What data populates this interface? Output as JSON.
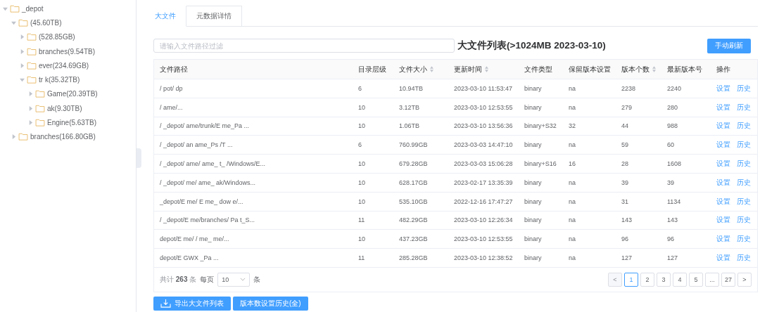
{
  "tree": [
    {
      "label": "_depot",
      "expanded": true,
      "children": [
        {
          "label": "(45.60TB)",
          "expanded": true,
          "children": [
            {
              "label": "(528.85GB)",
              "expanded": false
            },
            {
              "label": "branches(9.54TB)",
              "expanded": false
            },
            {
              "label": "ever(234.69GB)",
              "expanded": false
            },
            {
              "label": "tr k(35.32TB)",
              "expanded": true,
              "children": [
                {
                  "label": "Game(20.39TB)",
                  "expanded": false
                },
                {
                  "label": "ak(9.30TB)",
                  "expanded": false
                },
                {
                  "label": "Engine(5.63TB)",
                  "expanded": false
                }
              ]
            }
          ]
        },
        {
          "label": "branches(166.80GB)",
          "expanded": false
        }
      ]
    }
  ],
  "tabs": [
    {
      "label": "大文件",
      "selected": true
    },
    {
      "label": "元数据详情",
      "selected": false
    }
  ],
  "filter": {
    "placeholder": "请输入文件路径过滤"
  },
  "list_title": "大文件列表(>1024MB 2023-03-10)",
  "refresh_button": "手动刷新",
  "table": {
    "columns": [
      {
        "label": "文件路径",
        "sortable": false
      },
      {
        "label": "目录层级",
        "sortable": false
      },
      {
        "label": "文件大小",
        "sortable": true
      },
      {
        "label": "更新时间",
        "sortable": true
      },
      {
        "label": "文件类型",
        "sortable": false
      },
      {
        "label": "保留版本设置",
        "sortable": false
      },
      {
        "label": "版本个数",
        "sortable": true
      },
      {
        "label": "最新版本号",
        "sortable": false
      },
      {
        "label": "操作",
        "sortable": false
      }
    ],
    "rows": [
      {
        "cells": [
          "/  pot/  dp",
          "6",
          "10.94TB",
          "2023-03-10 11:53:47",
          "binary",
          "na",
          "2238",
          "2240"
        ],
        "actions": [
          "设置",
          "历史"
        ]
      },
      {
        "cells": [
          "/  ame/...",
          "10",
          "3.12TB",
          "2023-03-10 12:53:55",
          "binary",
          "na",
          "279",
          "280"
        ],
        "actions": [
          "设置",
          "历史"
        ]
      },
      {
        "cells": [
          "/  _depot/  ame/trunk/E  me_Pa  ...",
          "10",
          "1.06TB",
          "2023-03-10 13:56:36",
          "binary+S32",
          "32",
          "44",
          "988"
        ],
        "actions": [
          "设置",
          "历史"
        ]
      },
      {
        "cells": [
          "/  _depot/  an  ame_Ps  /T  ...",
          "6",
          "760.99GB",
          "2023-03-03 14:47:10",
          "binary",
          "na",
          "59",
          "60"
        ],
        "actions": [
          "设置",
          "历史"
        ]
      },
      {
        "cells": [
          "/  _depot/  ame/  ame_  t_  /Windows/E...",
          "10",
          "679.28GB",
          "2023-03-03 15:06:28",
          "binary+S16",
          "16",
          "28",
          "1608"
        ],
        "actions": [
          "设置",
          "历史"
        ]
      },
      {
        "cells": [
          "/  _depot/  me/  ame_  ak/Windows...",
          "10",
          "628.17GB",
          "2023-02-17 13:35:39",
          "binary",
          "na",
          "39",
          "39"
        ],
        "actions": [
          "设置",
          "历史"
        ]
      },
      {
        "cells": [
          "_depot/E  me/  E  me_  dow  e/...",
          "10",
          "535.10GB",
          "2022-12-16 17:47:27",
          "binary",
          "na",
          "31",
          "1134"
        ],
        "actions": [
          "设置",
          "历史"
        ]
      },
      {
        "cells": [
          "/  _depot/E  me/branches/  Pa  t_S...",
          "11",
          "482.29GB",
          "2023-03-10 12:26:34",
          "binary",
          "na",
          "143",
          "143"
        ],
        "actions": [
          "设置",
          "历史"
        ]
      },
      {
        "cells": [
          "depot/E  me/  /  me_  me/...",
          "10",
          "437.23GB",
          "2023-03-10 12:53:55",
          "binary",
          "na",
          "96",
          "96"
        ],
        "actions": [
          "设置",
          "历史"
        ]
      },
      {
        "cells": [
          "depot/E  GWX  _Pa  ...",
          "11",
          "285.28GB",
          "2023-03-10 12:38:52",
          "binary",
          "na",
          "127",
          "127"
        ],
        "actions": [
          "设置",
          "历史"
        ]
      }
    ]
  },
  "pagination": {
    "total_prefix": "共计",
    "total": "263",
    "total_suffix": "条",
    "per_page_label": "每页",
    "per_page": "10",
    "per_page_suffix": "条",
    "prev": "<",
    "next": ">",
    "pages": [
      {
        "label": "1",
        "selected": true
      },
      {
        "label": "2",
        "selected": false
      },
      {
        "label": "3",
        "selected": false
      },
      {
        "label": "4",
        "selected": false
      },
      {
        "label": "5",
        "selected": false
      },
      {
        "label": "...",
        "selected": false
      },
      {
        "label": "27",
        "selected": false
      }
    ]
  },
  "bottom_buttons": [
    {
      "kind": "export",
      "label": "导出大文件列表"
    },
    {
      "kind": "plain",
      "label": "版本数设置历史(全)"
    }
  ]
}
